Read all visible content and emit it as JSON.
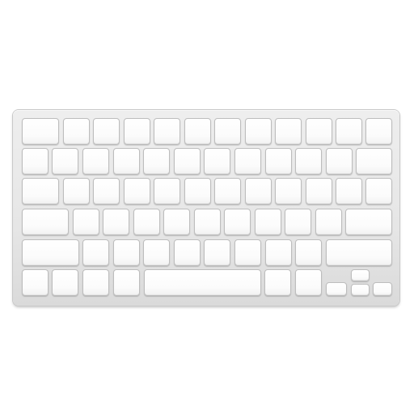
{
  "device": {
    "icon": "keyboard-icon",
    "body_color": "#e8e8e8",
    "key_color": "#fcfcfc",
    "key_border_color": "#bdbdbd"
  },
  "rows": [
    {
      "name": "function-row",
      "key_count": 12
    },
    {
      "name": "number-row",
      "key_count": 12
    },
    {
      "name": "top-letter-row",
      "key_count": 12
    },
    {
      "name": "home-row",
      "key_count": 11
    },
    {
      "name": "bottom-letter-row",
      "key_count": 10
    },
    {
      "name": "modifier-row",
      "key_count": 10
    }
  ]
}
